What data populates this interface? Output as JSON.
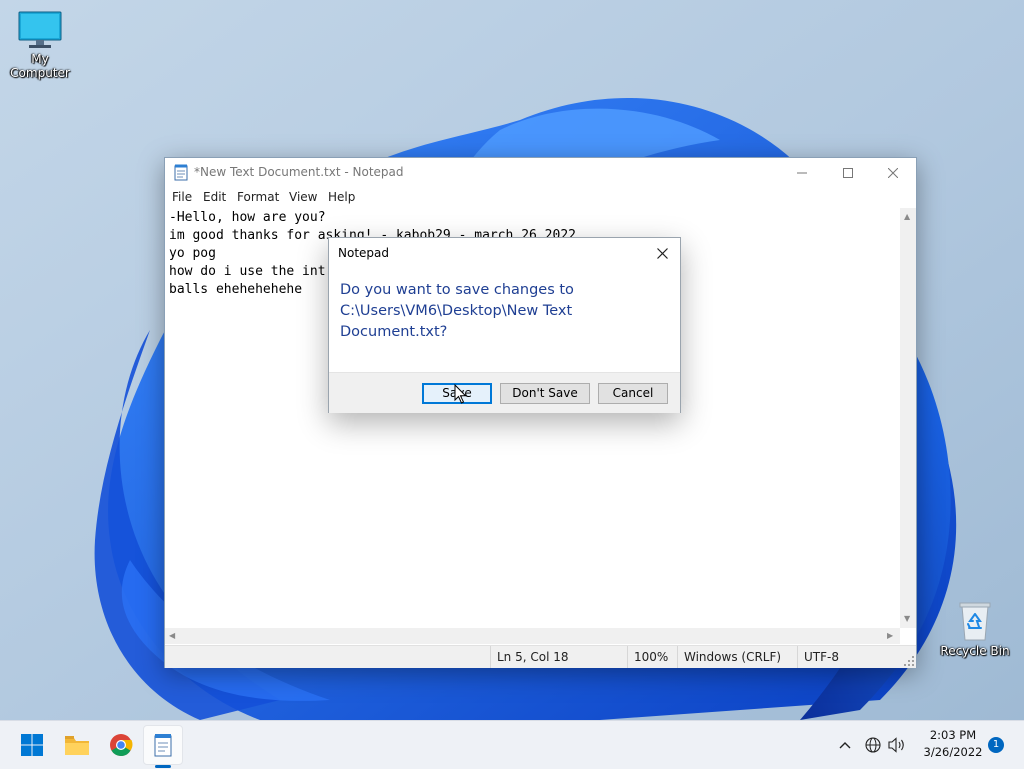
{
  "desktop": {
    "icons": [
      {
        "label": "My Computer"
      },
      {
        "label": "Recycle Bin"
      }
    ]
  },
  "notepad": {
    "title": "*New Text Document.txt - Notepad",
    "menu": [
      "File",
      "Edit",
      "Format",
      "View",
      "Help"
    ],
    "content": "-Hello, how are you?\nim good thanks for asking! - kabob29 - march 26 2022\nyo pog\nhow do i use the int\nballs ehehehehehe",
    "status": {
      "position": "Ln 5, Col 18",
      "zoom": "100%",
      "line_ending": "Windows (CRLF)",
      "encoding": "UTF-8"
    }
  },
  "dialog": {
    "title": "Notepad",
    "message": "Do you want to save changes to C:\\Users\\VM6\\Desktop\\New Text Document.txt?",
    "buttons": {
      "save": "Save",
      "dont_save": "Don't Save",
      "cancel": "Cancel"
    }
  },
  "taskbar": {
    "apps": [
      "start-icon",
      "file-explorer-icon",
      "chrome-icon",
      "notepad-icon"
    ],
    "clock": {
      "time": "2:03 PM",
      "date": "3/26/2022"
    },
    "notifications": "1"
  },
  "colors": {
    "accent": "#0078d7",
    "dialog_text": "#1f3f93",
    "taskbar_indicator": "#0067c0"
  }
}
